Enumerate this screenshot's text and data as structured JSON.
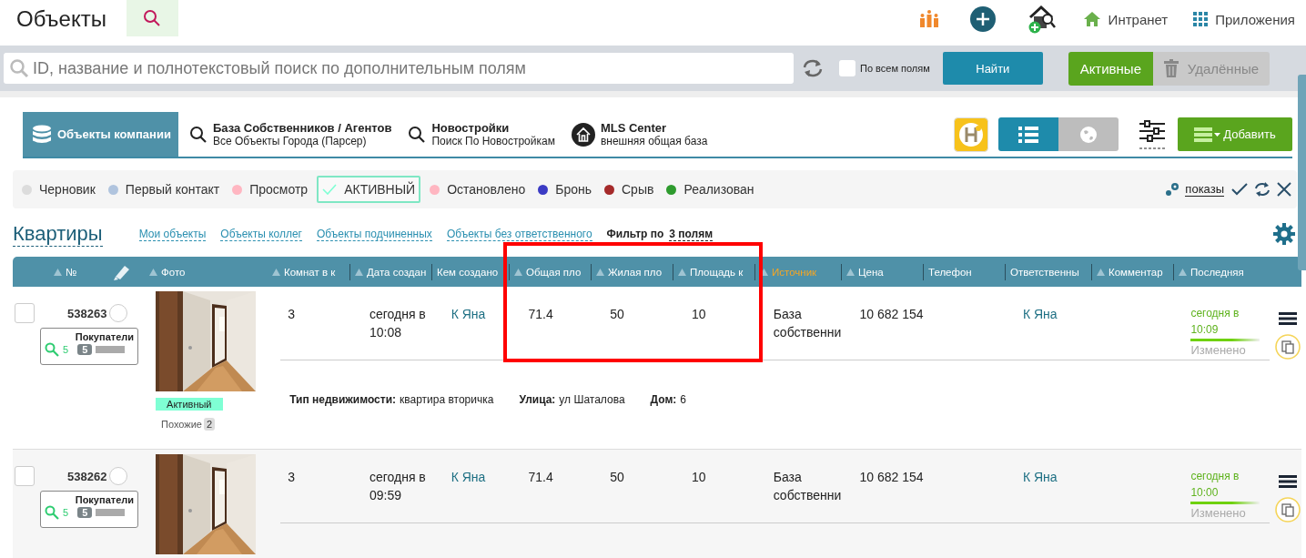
{
  "header": {
    "title": "Объекты",
    "links": [
      {
        "label": "Интранет",
        "kind": "home"
      },
      {
        "label": "Приложения",
        "kind": "apps"
      }
    ]
  },
  "search": {
    "placeholder": "ID, название и полнотекстовый поиск по дополнительным полям",
    "all_fields": {
      "label": "По всем полям",
      "checked": false
    },
    "button": "Найти",
    "scope": [
      {
        "label": "Активные",
        "selected": true
      },
      {
        "label": "Удалённые",
        "selected": false
      }
    ]
  },
  "sources": [
    {
      "title": "Объекты компании",
      "kind": "database",
      "selected": true
    },
    {
      "title": "База Собственников / Агентов",
      "subtitle": "Все Объекты Города (Парсер)",
      "kind": "search",
      "selected": false
    },
    {
      "title": "Новостройки",
      "subtitle": "Поиск По Новостройкам",
      "kind": "search",
      "selected": false
    },
    {
      "title": "MLS Center",
      "subtitle": "внешняя общая база",
      "kind": "mls",
      "selected": false
    }
  ],
  "views": [
    {
      "kind": "list",
      "selected": true
    },
    {
      "kind": "map",
      "selected": false
    }
  ],
  "add_button": "Добавить",
  "statuses": [
    {
      "label": "Черновик",
      "color": "#dcdcdc",
      "selected": false
    },
    {
      "label": "Первый контакт",
      "color": "#b0c4de",
      "selected": false
    },
    {
      "label": "Просмотр",
      "color": "#ffb6c1",
      "selected": false
    },
    {
      "label": "АКТИВНЫЙ",
      "color": "#7fffd4",
      "selected": true
    },
    {
      "label": "Остановлено",
      "color": "#ffb6c1",
      "selected": false
    },
    {
      "label": "Бронь",
      "color": "#3b3bc4",
      "selected": false
    },
    {
      "label": "Срыв",
      "color": "#a52a2a",
      "selected": false
    },
    {
      "label": "Реализован",
      "color": "#2e9b2e",
      "selected": false
    }
  ],
  "shows_link": "показы",
  "section": {
    "title": "Квартиры",
    "links": [
      "Мои объекты",
      "Объекты коллег",
      "Объекты подчиненных",
      "Объекты без ответственного"
    ],
    "filter_label": "Фильтр по",
    "filter_value": "3 полям"
  },
  "table": {
    "columns": [
      {
        "label": "№",
        "sortable": true,
        "highlighted": false
      },
      {
        "kind": "edit"
      },
      {
        "label": "Фото",
        "sortable": true,
        "highlighted": false
      },
      {
        "label": "Комнат в к",
        "sortable": true,
        "highlighted": false
      },
      {
        "label": "Дата создан",
        "sortable": true,
        "highlighted": false
      },
      {
        "label": "Кем создано",
        "sortable": false,
        "highlighted": false
      },
      {
        "label": "Общая пло",
        "sortable": true,
        "highlighted": false
      },
      {
        "label": "Жилая пло",
        "sortable": true,
        "highlighted": false
      },
      {
        "label": "Площадь к",
        "sortable": true,
        "highlighted": false
      },
      {
        "label": "Источник",
        "sortable": true,
        "highlighted": true
      },
      {
        "label": "Цена",
        "sortable": true,
        "highlighted": false
      },
      {
        "label": "Телефон",
        "sortable": false,
        "highlighted": false
      },
      {
        "label": "Ответственны",
        "sortable": false,
        "highlighted": false
      },
      {
        "label": "Комментар",
        "sortable": true,
        "highlighted": false
      },
      {
        "label": "Последняя",
        "sortable": true,
        "highlighted": false
      }
    ],
    "rows": [
      {
        "id": "538263",
        "checked": false,
        "flagged": false,
        "buyers_label": "Покупатели",
        "buyers_count": "5",
        "buyers_badge": "5",
        "status_badge": "Активный",
        "similar_label": "Похожие",
        "similar_count": "2",
        "rooms": "3",
        "created": "сегодня в 10:08",
        "author": "К Яна",
        "total_area": "71.4",
        "living_area": "50",
        "kitchen_area": "10",
        "source": "База собственни",
        "price": "10 682 154",
        "responsible": "К Яна",
        "updated": "сегодня в 10:09",
        "updated_note": "Изменено",
        "details": [
          {
            "label": "Тип недвижимости:",
            "value": "квартира вторичка"
          },
          {
            "label": "Улица:",
            "value": "ул Шаталова"
          },
          {
            "label": "Дом:",
            "value": "6"
          }
        ]
      },
      {
        "id": "538262",
        "checked": false,
        "flagged": false,
        "buyers_label": "Покупатели",
        "buyers_count": "5",
        "buyers_badge": "5",
        "rooms": "3",
        "created": "сегодня в 09:59",
        "author": "К Яна",
        "total_area": "71.4",
        "living_area": "50",
        "kitchen_area": "10",
        "source": "База собственни",
        "price": "10 682 154",
        "responsible": "К Яна",
        "updated": "сегодня в 10:00",
        "updated_note": "Изменено"
      }
    ]
  }
}
